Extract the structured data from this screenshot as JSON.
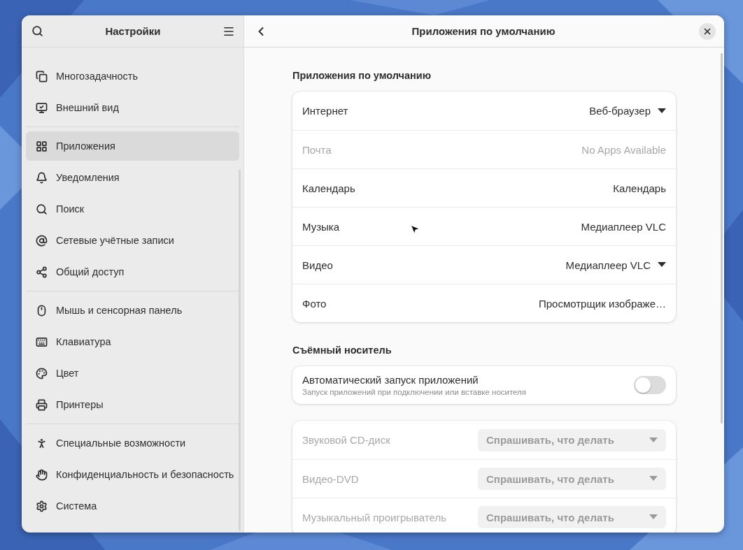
{
  "sidebar": {
    "title": "Настройки",
    "groups": [
      [
        {
          "label": "Многозадачность",
          "selected": false
        },
        {
          "label": "Внешний вид",
          "selected": false
        }
      ],
      [
        {
          "label": "Приложения",
          "selected": true
        },
        {
          "label": "Уведомления",
          "selected": false
        },
        {
          "label": "Поиск",
          "selected": false
        },
        {
          "label": "Сетевые учётные записи",
          "selected": false
        },
        {
          "label": "Общий доступ",
          "selected": false
        }
      ],
      [
        {
          "label": "Мышь и сенсорная панель",
          "selected": false
        },
        {
          "label": "Клавиатура",
          "selected": false
        },
        {
          "label": "Цвет",
          "selected": false
        },
        {
          "label": "Принтеры",
          "selected": false
        }
      ],
      [
        {
          "label": "Специальные возможности",
          "selected": false
        },
        {
          "label": "Конфиденциальность и безопасность",
          "selected": false
        },
        {
          "label": "Система",
          "selected": false
        }
      ]
    ]
  },
  "page": {
    "title": "Приложения по умолчанию"
  },
  "default_apps": {
    "heading": "Приложения по умолчанию",
    "rows": [
      {
        "label": "Интернет",
        "value": "Веб-браузер",
        "kind": "dropdown",
        "disabled": false
      },
      {
        "label": "Почта",
        "value": "No Apps Available",
        "kind": "value",
        "disabled": true
      },
      {
        "label": "Календарь",
        "value": "Календарь",
        "kind": "value",
        "disabled": false
      },
      {
        "label": "Музыка",
        "value": "Медиаплеер VLC",
        "kind": "value",
        "disabled": false
      },
      {
        "label": "Видео",
        "value": "Медиаплеер VLC",
        "kind": "dropdown",
        "disabled": false
      },
      {
        "label": "Фото",
        "value": "Просмотрщик изображе…",
        "kind": "value",
        "disabled": false
      }
    ]
  },
  "removable": {
    "heading": "Съёмный носитель",
    "autorun": {
      "title": "Автоматический запуск приложений",
      "subtitle": "Запуск приложений при подключении или вставке носителя",
      "on": false
    },
    "media": [
      {
        "label": "Звуковой CD-диск",
        "value": "Спрашивать, что делать",
        "disabled": true
      },
      {
        "label": "Видео-DVD",
        "value": "Спрашивать, что делать",
        "disabled": true
      },
      {
        "label": "Музыкальный проигрыватель",
        "value": "Спрашивать, что делать",
        "disabled": true
      }
    ]
  }
}
